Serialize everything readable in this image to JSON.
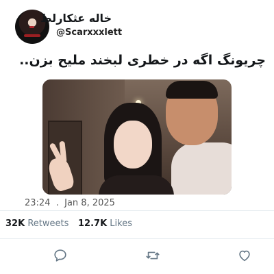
{
  "author": {
    "display_name": "خاله عثکارلط",
    "handle": "@Scarxxxlett"
  },
  "tweet": {
    "text": "چریونگ اگه در خطری لبخند ملیح بزن..",
    "timestamp": "23:24  .  Jan 8, 2025"
  },
  "stats": {
    "retweets_count": "32K",
    "retweets_label": "Retweets",
    "likes_count": "12.7K",
    "likes_label": "Likes"
  },
  "actions": {
    "reply_icon": "reply-icon",
    "retweet_icon": "retweet-icon",
    "like_icon": "like-icon"
  },
  "colors": {
    "text": "#14171a",
    "secondary": "#657786",
    "icon": "#657786",
    "divider": "#e6ecf0"
  }
}
